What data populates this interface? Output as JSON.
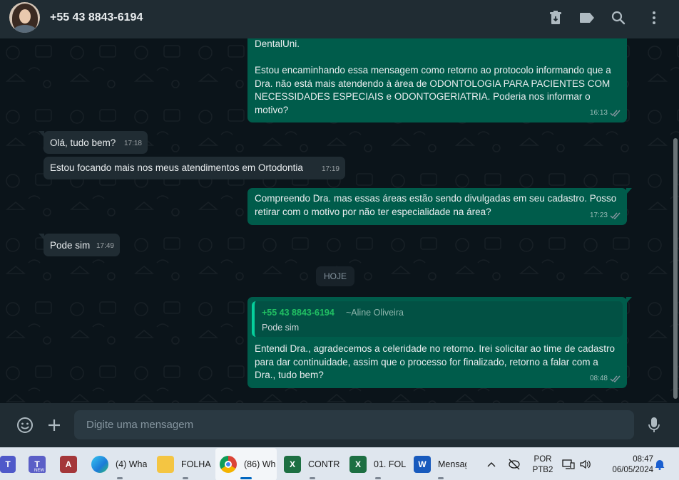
{
  "header": {
    "contact_name": "+55 43 8843-6194"
  },
  "messages": {
    "m1": {
      "text": "DentalUni.\n\nEstou encaminhando essa mensagem como retorno ao protocolo informando que a Dra. não está mais atendendo à área de ODONTOLOGIA PARA PACIENTES COM NECESSIDADES ESPECIAIS e ODONTOGERIATRIA. Poderia nos informar o motivo?",
      "time": "16:13"
    },
    "m2": {
      "text": "Olá, tudo bem?",
      "time": "17:18"
    },
    "m3": {
      "text": "Estou focando mais nos meus atendimentos em Ortodontia",
      "time": "17:19"
    },
    "m4": {
      "text": "Compreendo Dra. mas essas áreas estão sendo divulgadas em seu cadastro. Posso retirar com o motivo por não ter especialidade na área?",
      "time": "17:23"
    },
    "m5": {
      "text": "Pode sim",
      "time": "17:49"
    },
    "day": "HOJE",
    "m6": {
      "quote_sender": "+55 43 8843-6194",
      "quote_alias": "~Aline Oliveira",
      "quote_text": "Pode sim",
      "text": "Entendi Dra., agradecemos a celeridade no retorno. Irei solicitar ao time de cadastro para dar continuidade, assim que o processo for finalizado, retorno a falar com a Dra., tudo bem?",
      "time": "08:48"
    }
  },
  "composer": {
    "placeholder": "Digite uma mensagem"
  },
  "taskbar": {
    "apps": [
      {
        "label": "(4) Wha"
      },
      {
        "label": "FOLHA"
      },
      {
        "label": "(86) Wh"
      },
      {
        "label": "CONTR"
      },
      {
        "label": "01. FOL"
      },
      {
        "label": "Mensag"
      }
    ],
    "badge_new": "NEW",
    "lang_line1": "POR",
    "lang_line2": "PTB2",
    "clock_time": "08:47",
    "clock_date": "06/05/2024"
  },
  "colors": {
    "header_bg": "#202c33",
    "chat_bg": "#0b141a",
    "outgoing_bubble": "#005c4b",
    "incoming_bubble": "#202c33",
    "read_ticks": "#8696a0",
    "quote_accent": "#06cf9c"
  },
  "icons": [
    "archive-icon",
    "label-icon",
    "search-icon",
    "menu-icon",
    "emoji-icon",
    "plus-icon",
    "mic-icon",
    "double-check-icon"
  ]
}
